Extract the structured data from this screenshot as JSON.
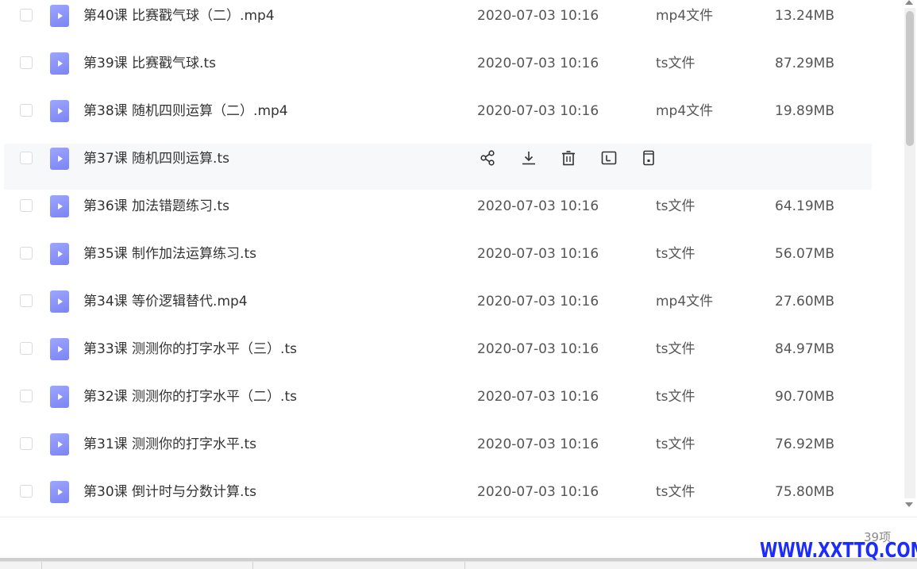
{
  "files": [
    {
      "name": "第40课 比赛戳气球（二）.mp4",
      "date": "2020-07-03 10:16",
      "type": "mp4文件",
      "size": "13.24MB"
    },
    {
      "name": "第39课 比赛戳气球.ts",
      "date": "2020-07-03 10:16",
      "type": "ts文件",
      "size": "87.29MB"
    },
    {
      "name": "第38课 随机四则运算（二）.mp4",
      "date": "2020-07-03 10:16",
      "type": "mp4文件",
      "size": "19.89MB"
    },
    {
      "name": "第37课 随机四则运算.ts",
      "date": "",
      "type": "",
      "size": "",
      "hovered": true
    },
    {
      "name": "第36课 加法错题练习.ts",
      "date": "2020-07-03 10:16",
      "type": "ts文件",
      "size": "64.19MB"
    },
    {
      "name": "第35课 制作加法运算练习.ts",
      "date": "2020-07-03 10:16",
      "type": "ts文件",
      "size": "56.07MB"
    },
    {
      "name": "第34课 等价逻辑替代.mp4",
      "date": "2020-07-03 10:16",
      "type": "mp4文件",
      "size": "27.60MB"
    },
    {
      "name": "第33课 测测你的打字水平（三）.ts",
      "date": "2020-07-03 10:16",
      "type": "ts文件",
      "size": "84.97MB"
    },
    {
      "name": "第32课 测测你的打字水平（二）.ts",
      "date": "2020-07-03 10:16",
      "type": "ts文件",
      "size": "90.70MB"
    },
    {
      "name": "第31课 测测你的打字水平.ts",
      "date": "2020-07-03 10:16",
      "type": "ts文件",
      "size": "76.92MB"
    },
    {
      "name": "第30课 倒计时与分数计算.ts",
      "date": "2020-07-03 10:16",
      "type": "ts文件",
      "size": "75.80MB"
    }
  ],
  "row_actions": [
    {
      "name": "share-icon",
      "label": "share"
    },
    {
      "name": "download-icon",
      "label": "download"
    },
    {
      "name": "delete-icon",
      "label": "delete"
    },
    {
      "name": "rename-icon",
      "label": "rename"
    },
    {
      "name": "move-icon",
      "label": "move"
    }
  ],
  "footer": {
    "item_count": "39项",
    "watermark": "WWW.XXTTQ.COM"
  },
  "colors": {
    "file_icon": "#7b84f2",
    "hover_row": "#f7f8fa",
    "watermark": "#1c2cff"
  }
}
